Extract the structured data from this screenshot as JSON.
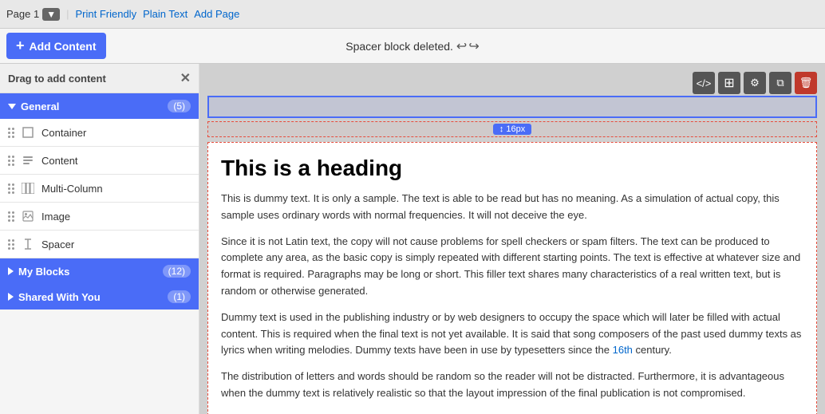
{
  "topbar": {
    "page_label": "Page 1",
    "page_badge": "▼",
    "link_print": "Print Friendly",
    "link_plain": "Plain Text",
    "link_add": "Add Page"
  },
  "secondbar": {
    "add_content_label": "Add Content",
    "status_message": "Spacer block deleted.",
    "undo_symbol": "↩",
    "redo_symbol": "↪"
  },
  "sidebar": {
    "drag_label": "Drag to add content",
    "close_symbol": "✕",
    "general_label": "General",
    "general_count": "(5)",
    "items": [
      {
        "label": "Container"
      },
      {
        "label": "Content"
      },
      {
        "label": "Multi-Column"
      },
      {
        "label": "Image"
      },
      {
        "label": "Spacer"
      }
    ],
    "my_blocks_label": "My Blocks",
    "my_blocks_count": "(12)",
    "shared_label": "Shared With You",
    "shared_count": "(1)"
  },
  "content": {
    "spacer_px": "↕ 16px",
    "heading": "This is a heading",
    "para1": "This is dummy text. It is only a sample. The text is able to be read but has no meaning. As a simulation of actual copy, this sample uses ordinary words with normal frequencies. It will not deceive the eye.",
    "para2": "Since it is not Latin text, the copy will not cause problems for spell checkers or spam filters. The text can be produced to complete any area, as the basic copy is simply repeated with different starting points. The text is effective at whatever size and format is required. Paragraphs may be long or short. This filler text shares many characteristics of a real written text, but is random or otherwise generated.",
    "para3": "Dummy text is used in the publishing industry or by web designers to occupy the space which will later be filled with actual content. This is required when the final text is not yet available. It is said that song composers of the past used dummy texts as lyrics when writing melodies. Dummy texts have been in use by typesetters since the 16th century.",
    "para4": "The distribution of letters and words should be random so the reader will not be distracted. Furthermore, it is advantageous when the dummy text is relatively realistic so that the layout impression of the final publication is not compromised."
  },
  "toolbar": {
    "code_icon": "</>",
    "grid_icon": "⊞",
    "gear_icon": "⚙",
    "copy_icon": "⧉",
    "trash_icon": "🗑"
  }
}
